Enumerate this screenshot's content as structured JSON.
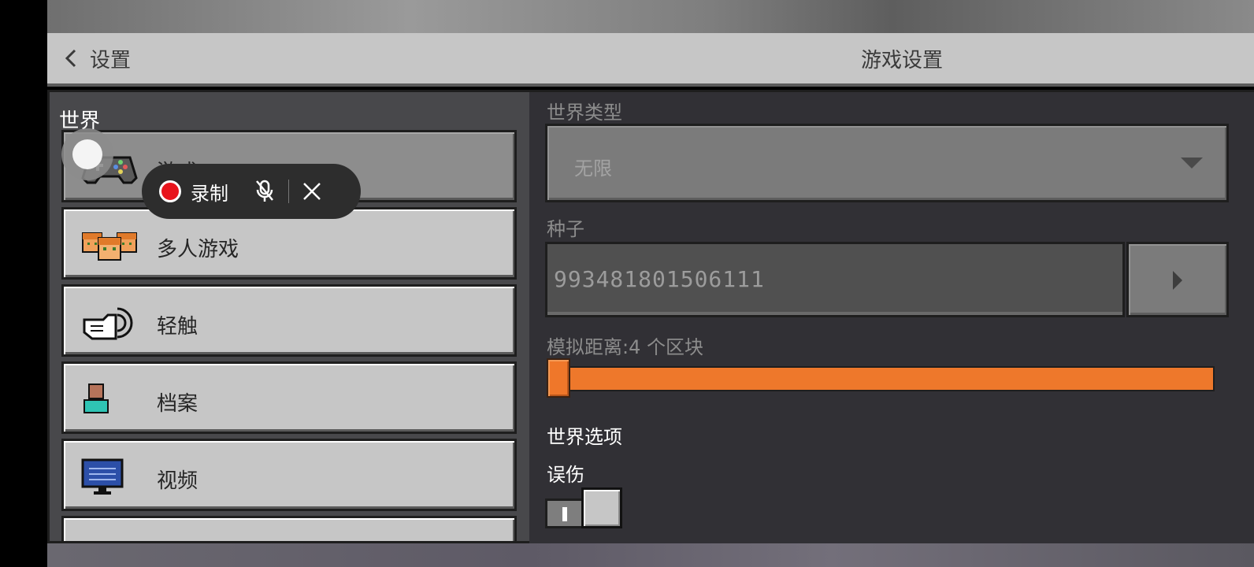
{
  "header": {
    "back_label": "设置",
    "title": "游戏设置"
  },
  "sidebar": {
    "section_label": "世界",
    "items": [
      {
        "label": "游戏",
        "icon": "gamepad-icon",
        "active": true
      },
      {
        "label": "多人游戏",
        "icon": "multiplayer-icon"
      },
      {
        "label": "轻触",
        "icon": "touch-hand-icon"
      },
      {
        "label": "档案",
        "icon": "profile-icon"
      },
      {
        "label": "视频",
        "icon": "monitor-icon"
      }
    ]
  },
  "world": {
    "world_type_label": "世界类型",
    "world_type_value": "无限",
    "seed_label": "种子",
    "seed_value": "993481801506111",
    "sim_distance_label": "模拟距离:4 个区块",
    "sim_distance": {
      "value": 4,
      "fraction": 0.0
    },
    "world_options_label": "世界选项",
    "friendly_fire_label": "误伤",
    "friendly_fire_on": false
  },
  "recorder": {
    "record_label": "录制",
    "mic_icon": "mic-muted-icon",
    "close_icon": "close-icon"
  },
  "colors": {
    "accent_orange": "#ee782b",
    "panel_bg": "#313035",
    "button_grey": "#c6c6c6",
    "record_red": "#e8141c"
  }
}
